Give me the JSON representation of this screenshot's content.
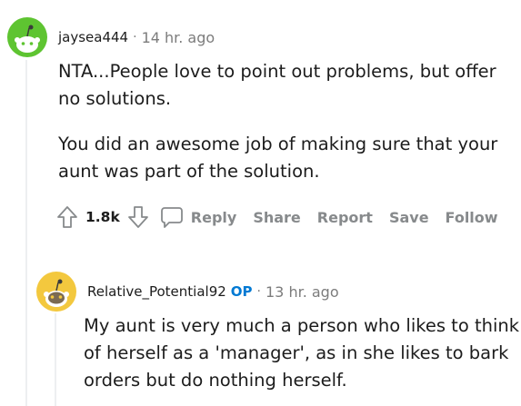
{
  "comment1": {
    "author": "jaysea444",
    "separator": "·",
    "time": "14 hr. ago",
    "paragraphs": [
      "NTA...People love to point out problems, but offer no solutions.",
      "You did an awesome job of making sure that your aunt was part of the solution."
    ],
    "score": "1.8k",
    "actions": {
      "reply": "Reply",
      "share": "Share",
      "report": "Report",
      "save": "Save",
      "follow": "Follow"
    }
  },
  "comment2": {
    "author": "Relative_Potential92",
    "op_badge": "OP",
    "separator": "·",
    "time": "13 hr. ago",
    "paragraphs": [
      "My aunt is very much a person who likes to think of herself as a 'manager', as in she likes to bark orders but do nothing herself."
    ]
  },
  "colors": {
    "avatar1": "#5ec431",
    "avatar2": "#f3c83e",
    "op": "#0079d3",
    "muted": "#878a8c"
  },
  "icons": [
    "snoo-avatar-icon",
    "upvote-icon",
    "downvote-icon",
    "reply-bubble-icon"
  ]
}
